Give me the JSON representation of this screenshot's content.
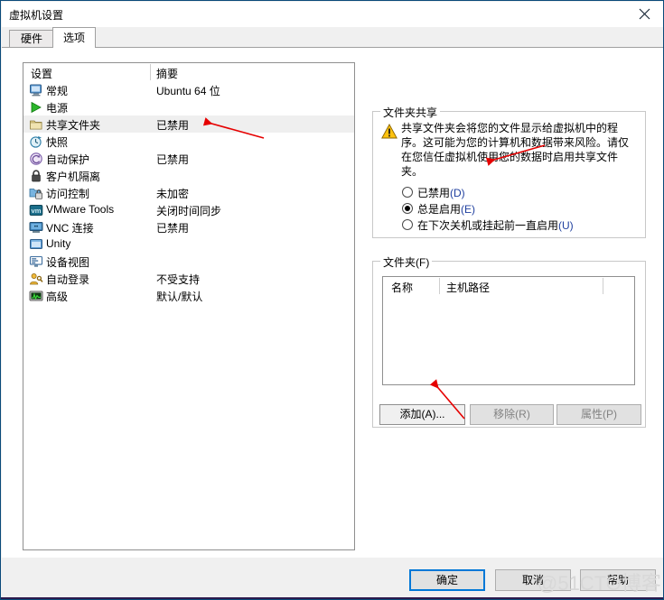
{
  "window": {
    "title": "虚拟机设置",
    "close_label": "✕",
    "close_icon": "close-icon"
  },
  "tabs": [
    {
      "label": "硬件",
      "active": false
    },
    {
      "label": "选项",
      "active": true
    }
  ],
  "settings_list": {
    "columns": {
      "setting": "设置",
      "summary": "摘要"
    },
    "rows": [
      {
        "label": "常规",
        "summary": "Ubuntu 64 位",
        "icon": "monitor-icon",
        "selected": false
      },
      {
        "label": "电源",
        "summary": "",
        "icon": "play-triangle-icon",
        "selected": false
      },
      {
        "label": "共享文件夹",
        "summary": "已禁用",
        "icon": "folder-icon",
        "selected": true
      },
      {
        "label": "快照",
        "summary": "",
        "icon": "snapshot-clock-icon",
        "selected": false
      },
      {
        "label": "自动保护",
        "summary": "已禁用",
        "icon": "circular-arrow-icon",
        "selected": false
      },
      {
        "label": "客户机隔离",
        "summary": "",
        "icon": "lock-icon",
        "selected": false
      },
      {
        "label": "访问控制",
        "summary": "未加密",
        "icon": "folder-lock-icon",
        "selected": false
      },
      {
        "label": "VMware Tools",
        "summary": "关闭时间同步",
        "icon": "vm-badge-icon",
        "selected": false
      },
      {
        "label": "VNC 连接",
        "summary": "已禁用",
        "icon": "vnc-monitor-icon",
        "selected": false
      },
      {
        "label": "Unity",
        "summary": "",
        "icon": "window-icon",
        "selected": false
      },
      {
        "label": "设备视图",
        "summary": "",
        "icon": "device-view-icon",
        "selected": false
      },
      {
        "label": "自动登录",
        "summary": "不受支持",
        "icon": "user-key-icon",
        "selected": false
      },
      {
        "label": "高级",
        "summary": "默认/默认",
        "icon": "graph-icon",
        "selected": false
      }
    ]
  },
  "sharing_group": {
    "title": "文件夹共享",
    "warning_icon": "warning-triangle-icon",
    "warning_text": "共享文件夹会将您的文件显示给虚拟机中的程序。这可能为您的计算机和数据带来风险。请仅在您信任虚拟机使用您的数据时启用共享文件夹。",
    "radios": [
      {
        "text": "已禁用",
        "accel": "(D)",
        "checked": false
      },
      {
        "text": "总是启用",
        "accel": "(E)",
        "checked": true
      },
      {
        "text": "在下次关机或挂起前一直启用",
        "accel": "(U)",
        "checked": false
      }
    ]
  },
  "folders_group": {
    "title": "文件夹(F)",
    "columns": [
      "名称",
      "主机路径"
    ],
    "rows": [],
    "buttons": [
      {
        "label": "添加(A)...",
        "enabled": true
      },
      {
        "label": "移除(R)",
        "enabled": false
      },
      {
        "label": "属性(P)",
        "enabled": false
      }
    ]
  },
  "footer": {
    "ok": "确定",
    "cancel": "取消",
    "help": "帮助"
  },
  "watermark": {
    "text": "@51CTO博客"
  },
  "colors": {
    "accent": "#0078d7",
    "window_border": "#0a4a7a",
    "dialog_bg": "#f0f0f0",
    "selection": "#efefef",
    "annotation_red": "#e60000",
    "accel_blue": "#1f3f9f",
    "warning_yellow": "#ffc20e"
  },
  "annotations": [
    {
      "name": "arrow-to-shared-folders-status",
      "color": "#e60000"
    },
    {
      "name": "arrow-to-always-enabled-radio",
      "color": "#e60000"
    },
    {
      "name": "arrow-to-add-button",
      "color": "#e60000"
    }
  ]
}
